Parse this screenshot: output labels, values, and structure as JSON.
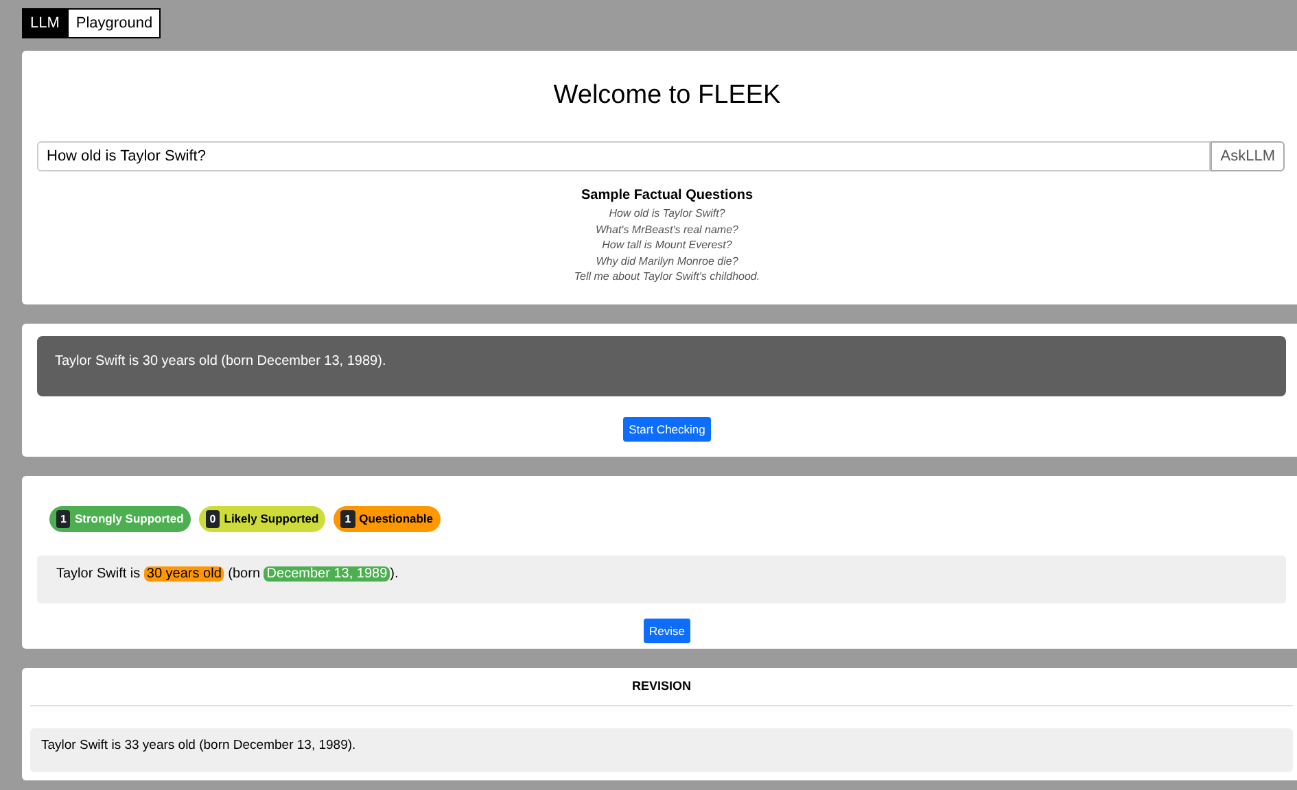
{
  "tabs": [
    {
      "label": "LLM",
      "selected": true
    },
    {
      "label": "Playground",
      "selected": false
    }
  ],
  "title": "Welcome to FLEEK",
  "question": {
    "value": "How old is Taylor Swift?",
    "button": "AskLLM"
  },
  "samples": {
    "heading": "Sample Factual Questions",
    "items": [
      "How old is Taylor Swift?",
      "What's MrBeast's real name?",
      "How tall is Mount Everest?",
      "Why did Marilyn Monroe die?",
      "Tell me about Taylor Swift's childhood."
    ]
  },
  "answer": {
    "text": "Taylor Swift is 30 years old (born December 13, 1989).",
    "button": "Start Checking"
  },
  "check": {
    "badges": [
      {
        "count": "1",
        "label": "Strongly Supported",
        "color": "#4caf50"
      },
      {
        "count": "0",
        "label": "Likely Supported",
        "color": "#cddc39"
      },
      {
        "count": "1",
        "label": "Questionable",
        "color": "#ff9800"
      }
    ],
    "segments": [
      {
        "kind": "plain",
        "text": "Taylor Swift is "
      },
      {
        "kind": "claim",
        "text": "30 years old",
        "color": "#ff9800"
      },
      {
        "kind": "plain",
        "text": " (born "
      },
      {
        "kind": "claim",
        "text": "December 13, 1989",
        "color": "#4caf50"
      },
      {
        "kind": "plain",
        "text": ")."
      }
    ],
    "button": "Revise"
  },
  "revision": {
    "heading": "REVISION",
    "text": "Taylor Swift is 33 years old (born December 13, 1989)."
  }
}
